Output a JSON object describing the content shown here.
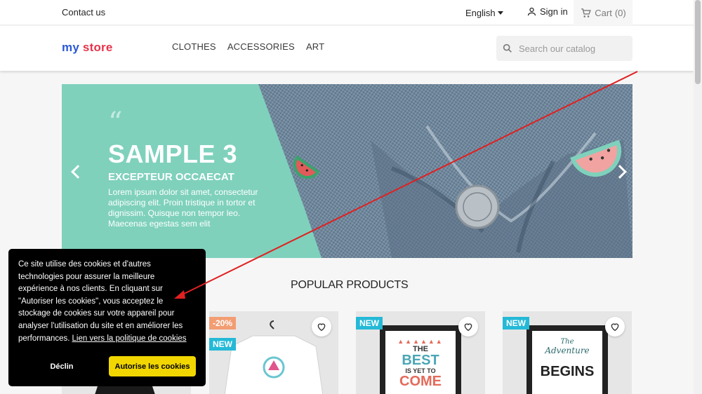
{
  "topbar": {
    "contact": "Contact us",
    "language": "English",
    "signin": "Sign in",
    "cart": "Cart",
    "cart_count": "(0)"
  },
  "header": {
    "logo_part1": "my",
    "logo_part2": "store",
    "nav": [
      "CLOTHES",
      "ACCESSORIES",
      "ART"
    ],
    "search_placeholder": "Search our catalog"
  },
  "slider": {
    "title": "SAMPLE 3",
    "subtitle": "EXCEPTEUR OCCAECAT",
    "description": "Lorem ipsum dolor sit amet, consectetur adipiscing elit. Proin tristique in tortor et dignissim. Quisque non tempor leo. Maecenas egestas sem elit"
  },
  "products": {
    "title": "POPULAR PRODUCTS",
    "items": [
      {
        "badges": []
      },
      {
        "badges": [
          "-20%",
          "NEW"
        ]
      },
      {
        "badges": [
          "NEW"
        ],
        "poster_text": [
          "THE",
          "BEST",
          "IS YET TO",
          "COME"
        ]
      },
      {
        "badges": [
          "NEW"
        ],
        "poster_text": [
          "The",
          "Adventure",
          "BEGINS"
        ]
      }
    ]
  },
  "cookie": {
    "message": "Ce site utilise des cookies et d'autres technologies pour assurer la meilleure expérience à nos clients. En cliquant sur \"Autoriser les cookies\", vous acceptez le stockage de cookies sur votre appareil pour analyser l'utilisation du site et en améliorer les performances.",
    "link": "Lien vers la politique de cookies",
    "decline": "Déclin",
    "accept": "Autorise les cookies"
  },
  "colors": {
    "accent_green": "#7fd1bc",
    "badge_new": "#24b9d7",
    "badge_discount": "#f39d72",
    "cookie_accept": "#f1d600",
    "annotation": "#e02020"
  }
}
